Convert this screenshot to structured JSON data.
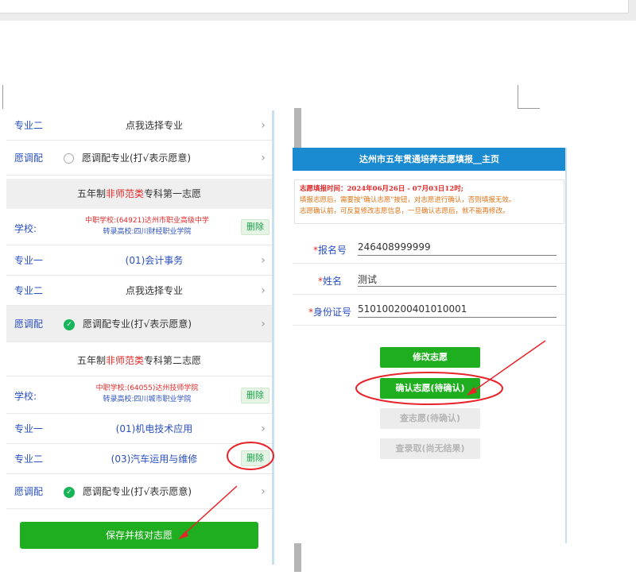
{
  "left_panel": {
    "rows_top": [
      {
        "label": "专业二",
        "value": "点我选择专业"
      },
      {
        "label": "愿调配",
        "value": "愿调配专业(打√表示愿意)"
      }
    ],
    "section1": {
      "head_prefix": "五年制",
      "head_red": "非师范类",
      "head_suffix": "专科第一志愿",
      "school_label": "学校:",
      "school_line1": "中职学校:(64921)达州市职业高级中学",
      "school_line2": "转录高校:四川财经职业学院",
      "delete_label": "删除",
      "major1_label": "专业一",
      "major1_value": "(01)会计事务",
      "major2_label": "专业二",
      "major2_value": "点我选择专业",
      "adjust_label": "愿调配",
      "adjust_value": "愿调配专业(打√表示愿意)"
    },
    "section2": {
      "head_prefix": "五年制",
      "head_red": "非师范类",
      "head_suffix": "专科第二志愿",
      "school_label": "学校:",
      "school_line1": "中职学校:(64055)达州技师学院",
      "school_line2": "转录高校:四川城市职业学院",
      "delete_label": "删除",
      "major1_label": "专业一",
      "major1_value": "(01)机电技术应用",
      "major2_label": "专业二",
      "major2_value": "(03)汽车运用与维修",
      "major2_delete": "删除",
      "adjust_label": "愿调配",
      "adjust_value": "愿调配专业(打√表示愿意)"
    },
    "save_button": "保存并核对志愿",
    "chevron": "›",
    "check": "✓"
  },
  "right_panel": {
    "title": "达州市五年贯通培养志愿填报__主页",
    "notice_line1": "志愿填报时间：2024年06月26日 - 07月03日12时;",
    "notice_line2": "填报志愿后，需要按\"确认志愿\"按钮，对志愿进行确认，否则填报无效。",
    "notice_line3": "志愿确认前，可反复修改志愿信息，一旦确认志愿后，就不能再修改。",
    "fields": [
      {
        "star": "*",
        "label": "报名号",
        "value": "246408999999"
      },
      {
        "star": "*",
        "label": "姓名",
        "value": "测试"
      },
      {
        "star": "*",
        "label": "身份证号",
        "value": "510100200401010001"
      }
    ],
    "buttons": {
      "modify": "修改志愿",
      "confirm": "确认志愿(待确认)",
      "view": "查志愿(待确认)",
      "result": "查录取(尚无结果)"
    }
  },
  "colors": {
    "header_blue": "#1b8bd1",
    "green": "#1fae1f",
    "red_annotation": "#e8232a",
    "label_blue": "#2a4fbf"
  }
}
